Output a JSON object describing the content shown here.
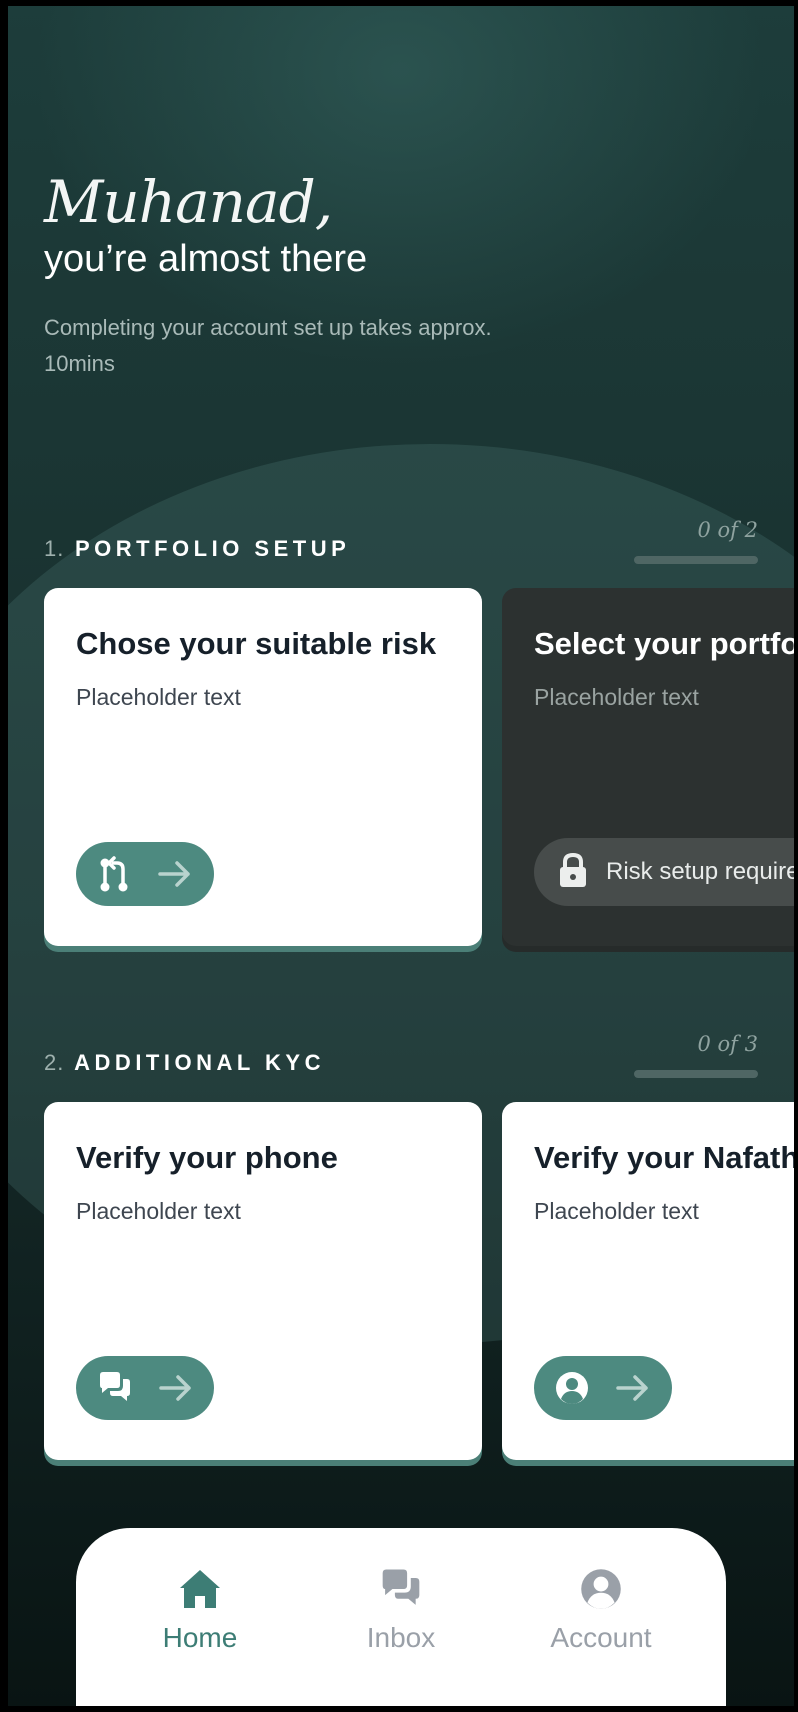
{
  "greeting": {
    "name": "Muhanad,",
    "subtitle": "you’re almost there",
    "description": "Completing your account set up takes approx. 10mins"
  },
  "sections": [
    {
      "number": "1.",
      "title": "PORTFOLIO SETUP",
      "progress_label": "0 of 2",
      "progress_fraction": 0,
      "cards": [
        {
          "title": "Chose your suitable risk",
          "description": "Placeholder text",
          "state": "active",
          "icon": "risk-compare-icon"
        },
        {
          "title": "Select your portfolio",
          "description": "Placeholder text",
          "state": "locked",
          "lock_text": "Risk setup required",
          "icon": "lock-icon"
        }
      ]
    },
    {
      "number": "2.",
      "title": "ADDITIONAL KYC",
      "progress_label": "0 of 3",
      "progress_fraction": 0,
      "cards": [
        {
          "title": "Verify your phone",
          "description": "Placeholder text",
          "state": "active",
          "icon": "chat-bubbles-icon"
        },
        {
          "title": "Verify your Nafath",
          "description": "Placeholder text",
          "state": "active",
          "icon": "user-circle-icon"
        }
      ]
    }
  ],
  "tabbar": {
    "items": [
      {
        "label": "Home",
        "icon": "home-icon",
        "active": true
      },
      {
        "label": "Inbox",
        "icon": "chat-bubbles-icon",
        "active": false
      },
      {
        "label": "Account",
        "icon": "user-circle-icon",
        "active": false
      }
    ]
  },
  "colors": {
    "accent": "#4d8a80",
    "background": "#1b3634",
    "active_tab": "#3d7d75"
  }
}
